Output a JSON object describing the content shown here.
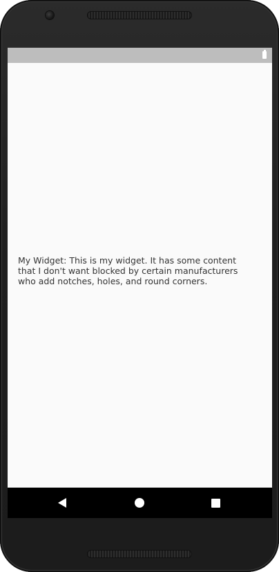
{
  "device": {
    "frame_color": "#222222",
    "status_bar_color": "#bdbdbd",
    "screen_background": "#fafafa",
    "nav_bar_color": "#000000"
  },
  "status_bar": {
    "icons": [
      "battery-icon"
    ]
  },
  "main": {
    "widget_text": "My Widget: This is my widget. It has some content that I don't want blocked by certain manufacturers who add notches, holes, and round corners."
  },
  "nav_bar": {
    "buttons": [
      "back-icon",
      "home-icon",
      "recents-icon"
    ]
  }
}
